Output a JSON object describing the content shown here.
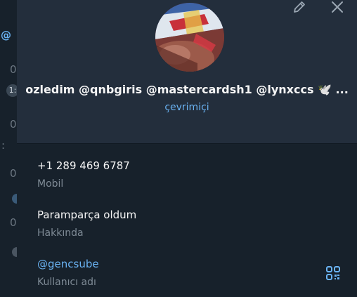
{
  "profile": {
    "name": "ozledim @qnbgiris @mastercardsh1 @lynxccs 🕊️ ...",
    "status": "çevrimiçi"
  },
  "info": {
    "phone_value": "+1 289 469 6787",
    "phone_label": "Mobil",
    "bio_value": "Paramparça oldum",
    "bio_label": "Hakkında",
    "username_value": "@gencsube",
    "username_label": "Kullanıcı adı"
  },
  "backdrop": {
    "glyphs": [
      "@",
      "0",
      "1:",
      "0",
      ":",
      "0",
      "0"
    ]
  },
  "icons": {
    "edit": "pencil-icon",
    "close": "close-icon",
    "qr": "qr-code-icon"
  },
  "colors": {
    "header_bg": "#232e3c",
    "panel_bg": "#17212b",
    "accent": "#6ab3f3",
    "muted": "#7f8b96",
    "text": "#f5f5f5"
  }
}
